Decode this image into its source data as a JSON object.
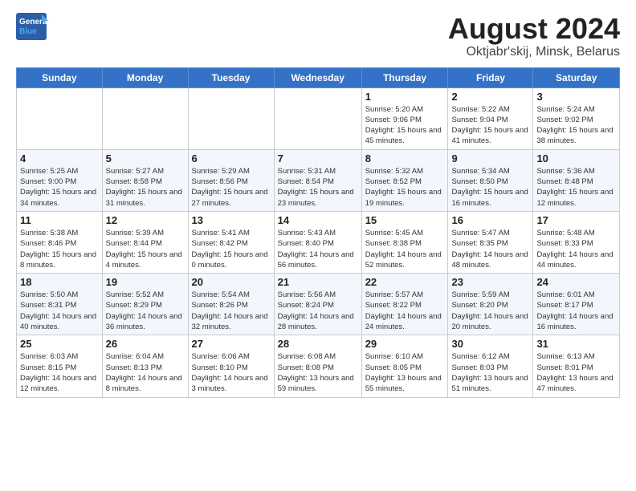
{
  "header": {
    "title": "August 2024",
    "subtitle": "Oktjabr'skij, Minsk, Belarus",
    "logo_line1": "General",
    "logo_line2": "Blue"
  },
  "weekdays": [
    "Sunday",
    "Monday",
    "Tuesday",
    "Wednesday",
    "Thursday",
    "Friday",
    "Saturday"
  ],
  "weeks": [
    [
      {
        "day": "",
        "info": ""
      },
      {
        "day": "",
        "info": ""
      },
      {
        "day": "",
        "info": ""
      },
      {
        "day": "",
        "info": ""
      },
      {
        "day": "1",
        "info": "Sunrise: 5:20 AM\nSunset: 9:06 PM\nDaylight: 15 hours\nand 45 minutes."
      },
      {
        "day": "2",
        "info": "Sunrise: 5:22 AM\nSunset: 9:04 PM\nDaylight: 15 hours\nand 41 minutes."
      },
      {
        "day": "3",
        "info": "Sunrise: 5:24 AM\nSunset: 9:02 PM\nDaylight: 15 hours\nand 38 minutes."
      }
    ],
    [
      {
        "day": "4",
        "info": "Sunrise: 5:25 AM\nSunset: 9:00 PM\nDaylight: 15 hours\nand 34 minutes."
      },
      {
        "day": "5",
        "info": "Sunrise: 5:27 AM\nSunset: 8:58 PM\nDaylight: 15 hours\nand 31 minutes."
      },
      {
        "day": "6",
        "info": "Sunrise: 5:29 AM\nSunset: 8:56 PM\nDaylight: 15 hours\nand 27 minutes."
      },
      {
        "day": "7",
        "info": "Sunrise: 5:31 AM\nSunset: 8:54 PM\nDaylight: 15 hours\nand 23 minutes."
      },
      {
        "day": "8",
        "info": "Sunrise: 5:32 AM\nSunset: 8:52 PM\nDaylight: 15 hours\nand 19 minutes."
      },
      {
        "day": "9",
        "info": "Sunrise: 5:34 AM\nSunset: 8:50 PM\nDaylight: 15 hours\nand 16 minutes."
      },
      {
        "day": "10",
        "info": "Sunrise: 5:36 AM\nSunset: 8:48 PM\nDaylight: 15 hours\nand 12 minutes."
      }
    ],
    [
      {
        "day": "11",
        "info": "Sunrise: 5:38 AM\nSunset: 8:46 PM\nDaylight: 15 hours\nand 8 minutes."
      },
      {
        "day": "12",
        "info": "Sunrise: 5:39 AM\nSunset: 8:44 PM\nDaylight: 15 hours\nand 4 minutes."
      },
      {
        "day": "13",
        "info": "Sunrise: 5:41 AM\nSunset: 8:42 PM\nDaylight: 15 hours\nand 0 minutes."
      },
      {
        "day": "14",
        "info": "Sunrise: 5:43 AM\nSunset: 8:40 PM\nDaylight: 14 hours\nand 56 minutes."
      },
      {
        "day": "15",
        "info": "Sunrise: 5:45 AM\nSunset: 8:38 PM\nDaylight: 14 hours\nand 52 minutes."
      },
      {
        "day": "16",
        "info": "Sunrise: 5:47 AM\nSunset: 8:35 PM\nDaylight: 14 hours\nand 48 minutes."
      },
      {
        "day": "17",
        "info": "Sunrise: 5:48 AM\nSunset: 8:33 PM\nDaylight: 14 hours\nand 44 minutes."
      }
    ],
    [
      {
        "day": "18",
        "info": "Sunrise: 5:50 AM\nSunset: 8:31 PM\nDaylight: 14 hours\nand 40 minutes."
      },
      {
        "day": "19",
        "info": "Sunrise: 5:52 AM\nSunset: 8:29 PM\nDaylight: 14 hours\nand 36 minutes."
      },
      {
        "day": "20",
        "info": "Sunrise: 5:54 AM\nSunset: 8:26 PM\nDaylight: 14 hours\nand 32 minutes."
      },
      {
        "day": "21",
        "info": "Sunrise: 5:56 AM\nSunset: 8:24 PM\nDaylight: 14 hours\nand 28 minutes."
      },
      {
        "day": "22",
        "info": "Sunrise: 5:57 AM\nSunset: 8:22 PM\nDaylight: 14 hours\nand 24 minutes."
      },
      {
        "day": "23",
        "info": "Sunrise: 5:59 AM\nSunset: 8:20 PM\nDaylight: 14 hours\nand 20 minutes."
      },
      {
        "day": "24",
        "info": "Sunrise: 6:01 AM\nSunset: 8:17 PM\nDaylight: 14 hours\nand 16 minutes."
      }
    ],
    [
      {
        "day": "25",
        "info": "Sunrise: 6:03 AM\nSunset: 8:15 PM\nDaylight: 14 hours\nand 12 minutes."
      },
      {
        "day": "26",
        "info": "Sunrise: 6:04 AM\nSunset: 8:13 PM\nDaylight: 14 hours\nand 8 minutes."
      },
      {
        "day": "27",
        "info": "Sunrise: 6:06 AM\nSunset: 8:10 PM\nDaylight: 14 hours\nand 3 minutes."
      },
      {
        "day": "28",
        "info": "Sunrise: 6:08 AM\nSunset: 8:08 PM\nDaylight: 13 hours\nand 59 minutes."
      },
      {
        "day": "29",
        "info": "Sunrise: 6:10 AM\nSunset: 8:05 PM\nDaylight: 13 hours\nand 55 minutes."
      },
      {
        "day": "30",
        "info": "Sunrise: 6:12 AM\nSunset: 8:03 PM\nDaylight: 13 hours\nand 51 minutes."
      },
      {
        "day": "31",
        "info": "Sunrise: 6:13 AM\nSunset: 8:01 PM\nDaylight: 13 hours\nand 47 minutes."
      }
    ]
  ]
}
